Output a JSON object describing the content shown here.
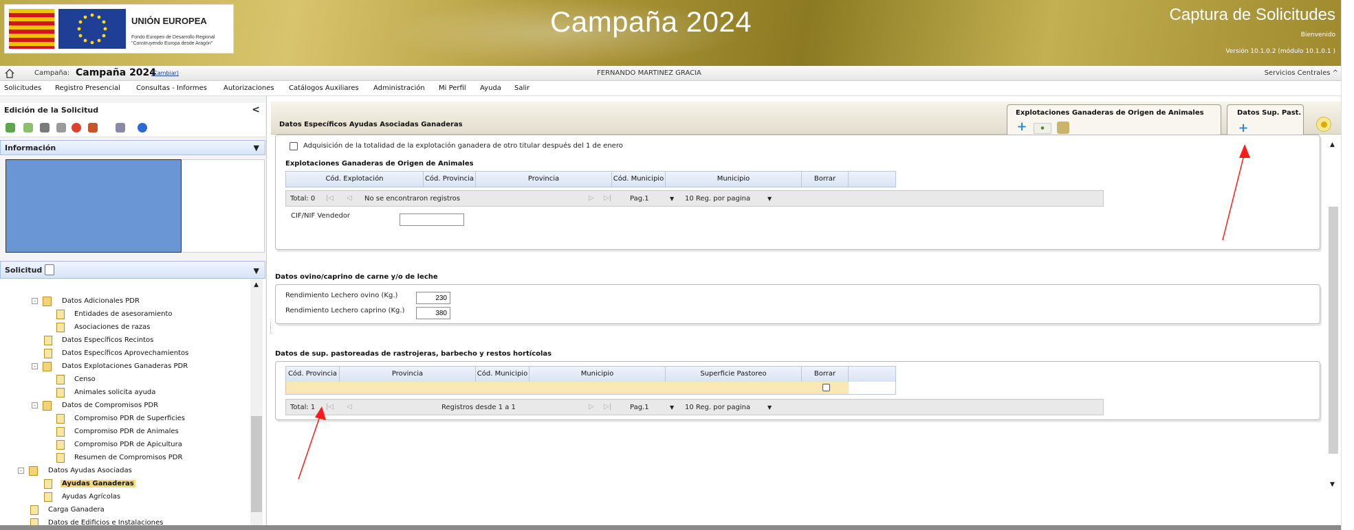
{
  "header": {
    "eu_title": "UNIÓN EUROPEA",
    "eu_subtitle_1": "Fondo Europeo de Desarrollo Regional",
    "eu_subtitle_2": "\"Construyendo Europa desde Aragón\"",
    "campaign_title": "Campaña 2024",
    "app_title": "Captura de Solicitudes",
    "welcome": "Bienvenido",
    "version": "Versión 10.1.0.2 (módulo 10.1.0.1 )"
  },
  "campaign_bar": {
    "label": "Campaña:",
    "value": "Campaña 2024",
    "change_link": "(Cambiar)",
    "user": "FERNANDO MARTINEZ GRACIA",
    "services": "Servicios Centrales ^"
  },
  "menu": {
    "items": [
      "Solicitudes",
      "Registro Presencial",
      "Consultas - Informes",
      "Autorizaciones",
      "Catálogos Auxiliares",
      "Administración",
      "Mi Perfil",
      "Ayuda",
      "Salir"
    ]
  },
  "left_panel": {
    "title": "Edición de la Solicitud",
    "collapse": "<",
    "info_title": "Información",
    "solicitud_title": "Solicitud",
    "tree": [
      "Datos Adicionales PDR",
      "Entidades de asesoramiento",
      "Asociaciones de razas",
      "Datos Específicos Recintos",
      "Datos Específicos Aprovechamientos",
      "Datos Explotaciones Ganaderas PDR",
      "Censo",
      "Animales solicita ayuda",
      "Datos de Compromisos PDR",
      "Compromiso PDR de Superficies",
      "Compromiso PDR de Animales",
      "Compromiso PDR de Apicultura",
      "Resumen de Compromisos PDR",
      "Datos Ayudas Asociadas",
      "Ayudas Ganaderas",
      "Ayudas Agrícolas",
      "Carga Ganadera",
      "Datos de Edificios e Instalaciones"
    ]
  },
  "content": {
    "title": "Datos Específicos Ayudas Asociadas Ganaderas",
    "group_origin_title": "Explotaciones Ganaderas de Origen de Animales",
    "group_past_title": "Datos Sup. Past.",
    "adquisicion_label": "Adquisición de la totalidad de la explotación ganadera de otro titular después del 1 de enero",
    "origen": {
      "section_title": "Explotaciones Ganaderas de Origen de Animales",
      "columns": [
        "Cód. Explotación",
        "Cód. Provincia",
        "Provincia",
        "Cód. Municipio",
        "Municipio",
        "Borrar"
      ],
      "pager_total": "Total: 0",
      "pager_status": "No se encontraron registros",
      "pager_page": "Pag.1",
      "pager_size": "10 Reg. por pagina",
      "cif_label": "CIF/NIF Vendedor",
      "cif_value": ""
    },
    "ovino": {
      "section_title": "Datos ovino/caprino de carne y/o de leche",
      "ovino_label": "Rendimiento Lechero ovino (Kg.)",
      "ovino_value": "230",
      "caprino_label": "Rendimiento Lechero caprino (Kg.)",
      "caprino_value": "380"
    },
    "pastos": {
      "section_title": "Datos de sup. pastoreadas de rastrojeras, barbecho y restos hortícolas",
      "columns": [
        "Cód. Provincia",
        "Provincia",
        "Cód. Municipio",
        "Municipio",
        "Superficie Pastoreo",
        "Borrar"
      ],
      "pager_total": "Total: 1",
      "pager_status": "Registros desde 1 a 1",
      "pager_page": "Pag.1",
      "pager_size": "10 Reg. por pagina"
    }
  },
  "colors": {
    "header_gold": "#a89235",
    "selected_row": "#fbe7b4",
    "grid_header": "#d9e4f3",
    "arrow": "#ff1a1a"
  }
}
